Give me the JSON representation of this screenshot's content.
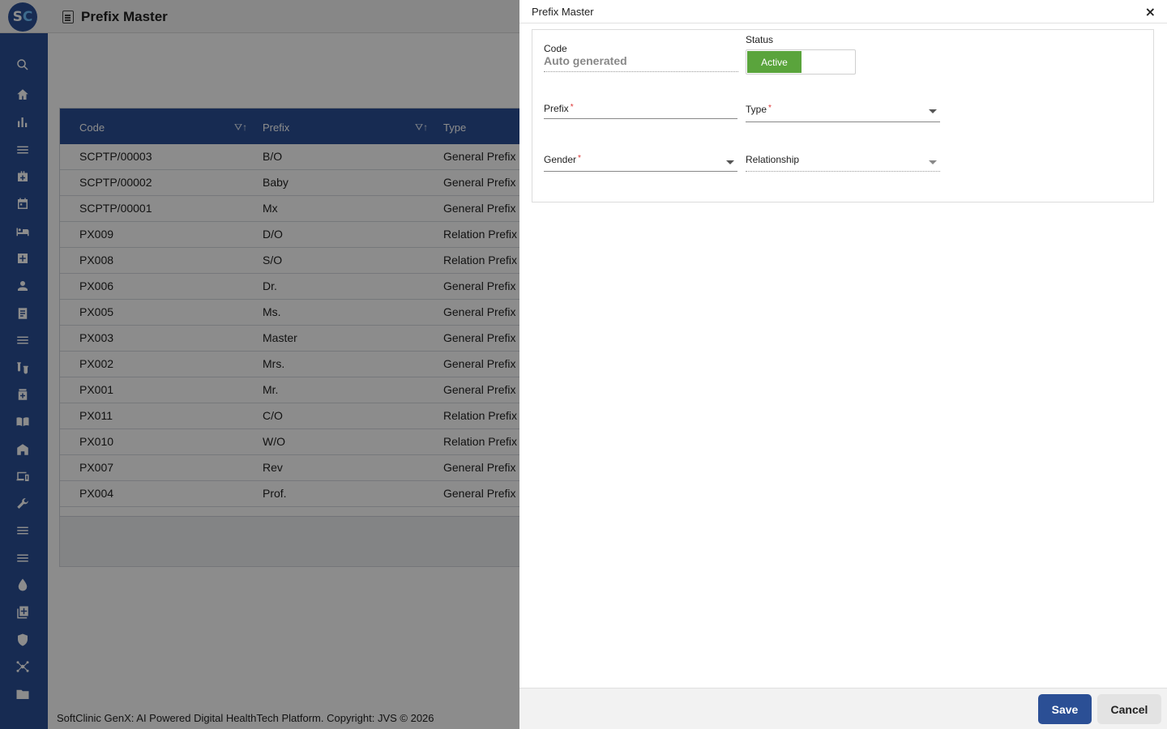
{
  "app": {
    "logo_text_s": "S",
    "logo_text_c": "C",
    "title": "Prefix Master"
  },
  "sidebar": {
    "icons": [
      "search-icon",
      "home-icon",
      "bar-chart-icon",
      "menu-icon",
      "medical-bag-icon",
      "calendar-icon",
      "bed-icon",
      "plus-box-icon",
      "person-icon",
      "document-icon",
      "list-icon",
      "vials-icon",
      "medicine-bottle-icon",
      "book-icon",
      "building-icon",
      "devices-icon",
      "wrench-icon",
      "menu-icon",
      "menu-icon",
      "drop-icon",
      "add-copy-icon",
      "shield-icon",
      "network-icon",
      "folder-icon"
    ]
  },
  "grid": {
    "columns": [
      "Code",
      "Prefix",
      "Type"
    ],
    "rows": [
      {
        "code": "SCPTP/00003",
        "prefix": "B/O",
        "type": "General Prefix"
      },
      {
        "code": "SCPTP/00002",
        "prefix": "Baby",
        "type": "General Prefix"
      },
      {
        "code": "SCPTP/00001",
        "prefix": "Mx",
        "type": "General Prefix"
      },
      {
        "code": "PX009",
        "prefix": "D/O",
        "type": "Relation Prefix"
      },
      {
        "code": "PX008",
        "prefix": "S/O",
        "type": "Relation Prefix"
      },
      {
        "code": "PX006",
        "prefix": "Dr.",
        "type": "General Prefix"
      },
      {
        "code": "PX005",
        "prefix": "Ms.",
        "type": "General Prefix"
      },
      {
        "code": "PX003",
        "prefix": "Master",
        "type": "General Prefix"
      },
      {
        "code": "PX002",
        "prefix": "Mrs.",
        "type": "General Prefix"
      },
      {
        "code": "PX001",
        "prefix": "Mr.",
        "type": "General Prefix"
      },
      {
        "code": "PX011",
        "prefix": "C/O",
        "type": "Relation Prefix"
      },
      {
        "code": "PX010",
        "prefix": "W/O",
        "type": "Relation Prefix"
      },
      {
        "code": "PX007",
        "prefix": "Rev",
        "type": "General Prefix"
      },
      {
        "code": "PX004",
        "prefix": "Prof.",
        "type": "General Prefix"
      }
    ]
  },
  "footer": {
    "text": "SoftClinic GenX: AI Powered Digital HealthTech Platform. Copyright: JVS © 2026"
  },
  "dialog": {
    "title": "Prefix Master",
    "close": "×",
    "code_label": "Code",
    "code_value": "Auto generated",
    "status_label": "Status",
    "status_value": "Active",
    "prefix_label": "Prefix",
    "type_label": "Type",
    "gender_label": "Gender",
    "relationship_label": "Relationship",
    "required_mark": "*",
    "save_label": "Save",
    "cancel_label": "Cancel"
  },
  "colors": {
    "brand": "#2b4f95",
    "active_toggle": "#5aa43c",
    "required": "#dd3333"
  }
}
